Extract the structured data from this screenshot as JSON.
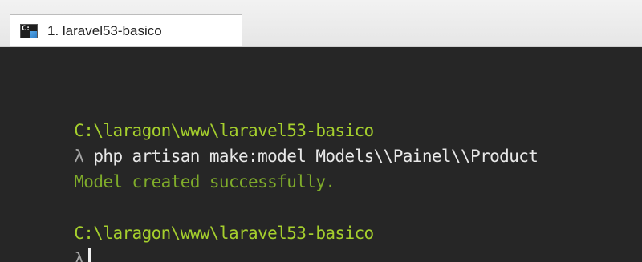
{
  "window": {
    "tab_label": "1. laravel53-basico"
  },
  "terminal": {
    "lines": [
      {
        "kind": "path",
        "text": "C:\\laragon\\www\\laravel53-basico"
      },
      {
        "kind": "command",
        "prompt": "λ",
        "text": "php artisan make:model Models\\\\Painel\\\\Product"
      },
      {
        "kind": "output",
        "text": "Model created successfully."
      },
      {
        "kind": "blank",
        "text": ""
      },
      {
        "kind": "path",
        "text": "C:\\laragon\\www\\laravel53-basico"
      },
      {
        "kind": "input",
        "prompt": "λ",
        "text": ""
      }
    ]
  },
  "colors": {
    "background": "#262626",
    "path": "#a5cf2d",
    "success": "#7fac2a",
    "command": "#e8e8e8"
  }
}
